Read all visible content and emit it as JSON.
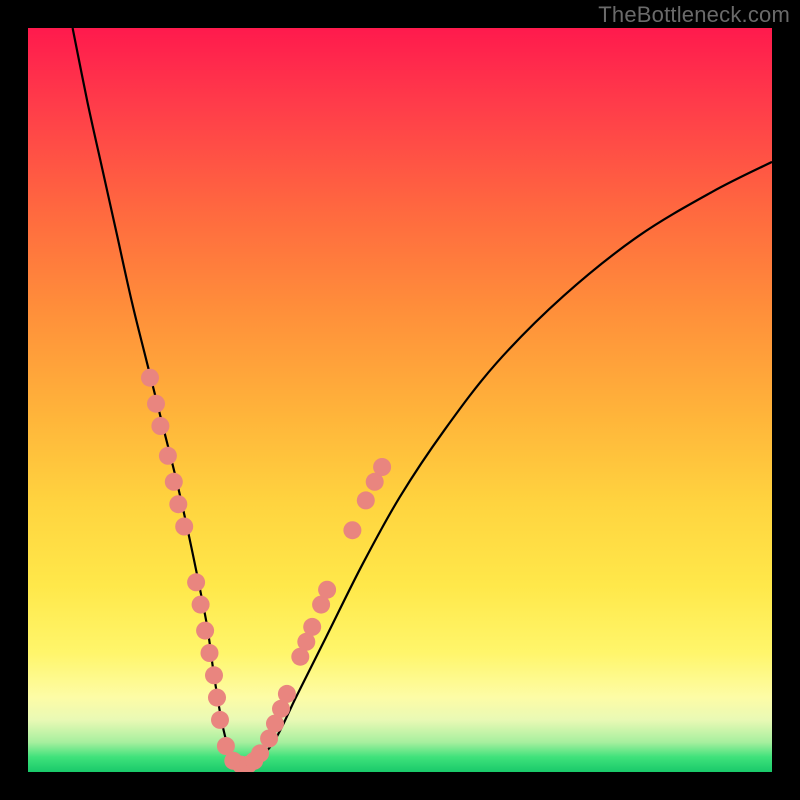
{
  "watermark": "TheBottleneck.com",
  "colors": {
    "background_frame": "#000000",
    "gradient_top": "#ff1a4d",
    "gradient_bottom": "#19c96a",
    "curve": "#000000",
    "beads": "#e9857f",
    "watermark_text": "#6a6a6a"
  },
  "chart_data": {
    "type": "line",
    "title": "",
    "xlabel": "",
    "ylabel": "",
    "xlim": [
      0,
      100
    ],
    "ylim": [
      0,
      100
    ],
    "grid": false,
    "legend": false,
    "series": [
      {
        "name": "bottleneck-curve",
        "x": [
          6,
          8,
          10,
          12,
          14,
          16,
          18,
          20,
          22,
          24,
          25,
          26,
          27,
          28,
          30,
          33,
          36,
          40,
          45,
          50,
          56,
          63,
          72,
          82,
          92,
          100
        ],
        "y": [
          100,
          90,
          81,
          72,
          63,
          55,
          47,
          39,
          30,
          20,
          13,
          7,
          3,
          1,
          1,
          4,
          10,
          18,
          28,
          37,
          46,
          55,
          64,
          72,
          78,
          82
        ]
      }
    ],
    "annotations": {
      "name": "beads",
      "points_xy": [
        [
          16.4,
          53.0
        ],
        [
          17.2,
          49.5
        ],
        [
          17.8,
          46.5
        ],
        [
          18.8,
          42.5
        ],
        [
          19.6,
          39.0
        ],
        [
          20.2,
          36.0
        ],
        [
          21.0,
          33.0
        ],
        [
          22.6,
          25.5
        ],
        [
          23.2,
          22.5
        ],
        [
          23.8,
          19.0
        ],
        [
          24.4,
          16.0
        ],
        [
          25.0,
          13.0
        ],
        [
          25.4,
          10.0
        ],
        [
          25.8,
          7.0
        ],
        [
          26.6,
          3.5
        ],
        [
          27.6,
          1.5
        ],
        [
          28.6,
          1.0
        ],
        [
          29.6,
          1.0
        ],
        [
          30.4,
          1.5
        ],
        [
          31.2,
          2.5
        ],
        [
          32.4,
          4.5
        ],
        [
          33.2,
          6.5
        ],
        [
          34.0,
          8.5
        ],
        [
          34.8,
          10.5
        ],
        [
          36.6,
          15.5
        ],
        [
          37.4,
          17.5
        ],
        [
          38.2,
          19.5
        ],
        [
          39.4,
          22.5
        ],
        [
          40.2,
          24.5
        ],
        [
          43.6,
          32.5
        ],
        [
          45.4,
          36.5
        ],
        [
          46.6,
          39.0
        ],
        [
          47.6,
          41.0
        ]
      ]
    }
  }
}
